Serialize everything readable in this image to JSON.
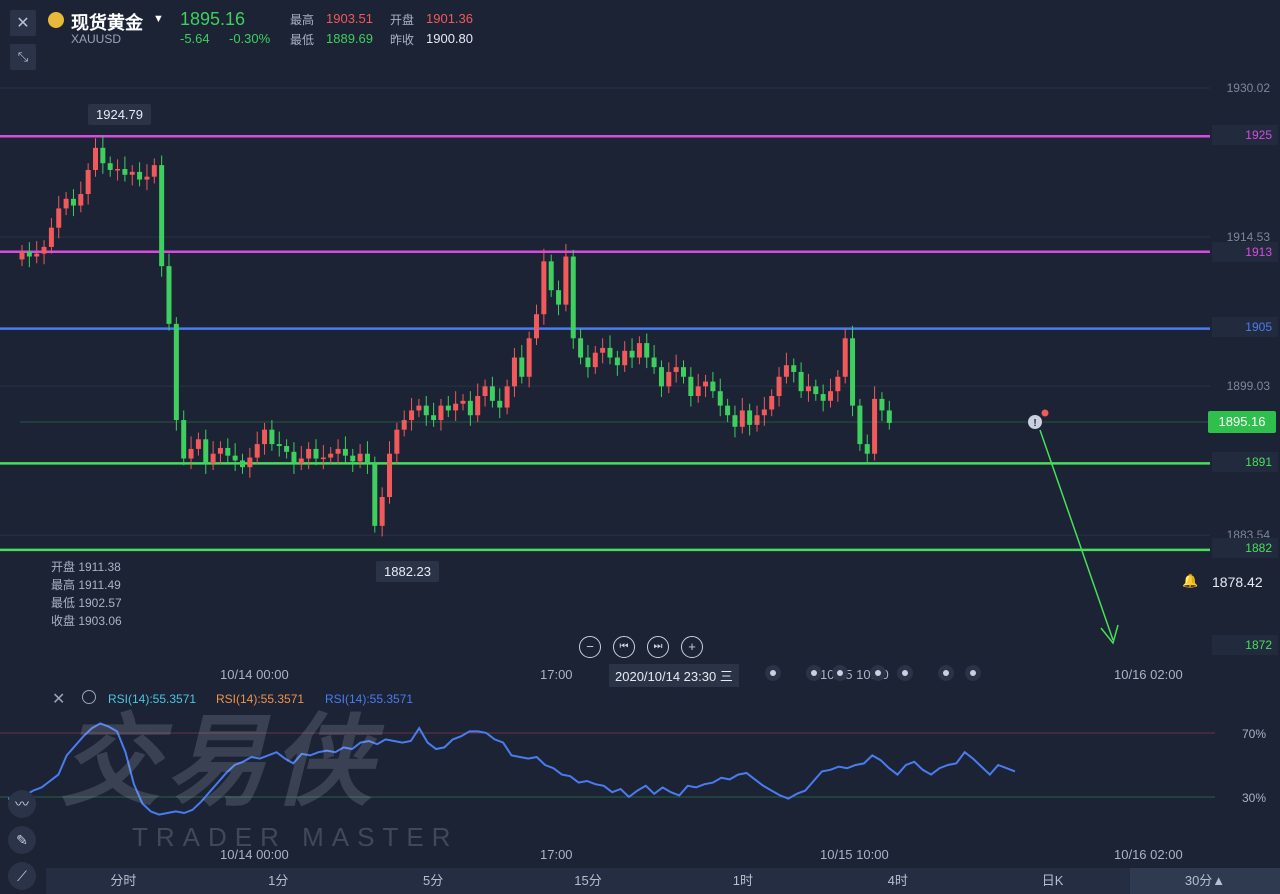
{
  "header": {
    "title": "现货黄金",
    "symbol": "XAUUSD",
    "price": "1895.16",
    "change": "-5.64",
    "change_pct": "-0.30%",
    "high_label": "最高",
    "high": "1903.51",
    "open_label": "开盘",
    "open": "1901.36",
    "low_label": "最低",
    "low": "1889.69",
    "prev_label": "昨收",
    "prev": "1900.80"
  },
  "axis": {
    "y_labels": [
      "1930.02",
      "1914.53",
      "1899.03",
      "1883.54"
    ],
    "x_labels": [
      "10/14 00:00",
      "17:00",
      "10/15 10:00",
      "10/16 02:00"
    ]
  },
  "levels": [
    {
      "value": "1925",
      "color": "#d74be0"
    },
    {
      "value": "1913",
      "color": "#d74be0"
    },
    {
      "value": "1905",
      "color": "#4a7cf0"
    },
    {
      "value": "1891",
      "color": "#48df58"
    },
    {
      "value": "1882",
      "color": "#48df58"
    },
    {
      "value": "1872",
      "color": "#48df58"
    }
  ],
  "current_price_tag": "1895.16",
  "alert_price": "1878.42",
  "tooltips": {
    "high_point": "1924.79",
    "low_point": "1882.23"
  },
  "ohlc_panel": {
    "open": "开盘 1911.38",
    "high": "最高 1911.49",
    "low": "最低 1902.57",
    "close": "收盘 1903.06"
  },
  "crosshair_time": "2020/10/14 23:30 三",
  "rsi": {
    "labels": [
      "RSI(14):55.3571",
      "RSI(14):55.3571",
      "RSI(14):55.3571"
    ],
    "levels": [
      "70%",
      "30%"
    ]
  },
  "watermark": {
    "cn": "交易侠",
    "en": "TRADER MASTER"
  },
  "tabs": [
    "分时",
    "1分",
    "5分",
    "15分",
    "1时",
    "4时",
    "日K",
    "30分▲"
  ],
  "colors": {
    "up": "#f15a5a",
    "down": "#3fcf5e",
    "bg": "#1b2335",
    "rsi": "#4a7cf0"
  }
}
